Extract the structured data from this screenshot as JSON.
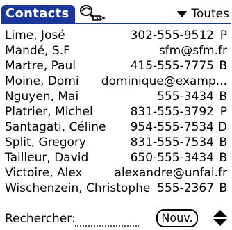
{
  "app": {
    "title": "Contacts"
  },
  "header": {
    "category": "Toutes",
    "lookup_icon": "lookup-icon",
    "category_icon": "triangle-down-icon"
  },
  "contacts": [
    {
      "name": "Lime, José",
      "value": "302-555-9512",
      "type": "P"
    },
    {
      "name": "Mandé, S.F",
      "value": "sfm@sfm.fr",
      "type": ""
    },
    {
      "name": "Martre, Paul",
      "value": "415-555-7775",
      "type": "B"
    },
    {
      "name": "Moine, Domi",
      "value": "dominique@examp...",
      "type": ""
    },
    {
      "name": "Nguyen, Mai",
      "value": "555-3434",
      "type": "B"
    },
    {
      "name": "Platrier, Michel",
      "value": "831-555-3792",
      "type": "P"
    },
    {
      "name": "Santagati, Céline",
      "value": "954-555-7534",
      "type": "D"
    },
    {
      "name": "Split, Gregory",
      "value": "831-555-7534",
      "type": "B"
    },
    {
      "name": "Tailleur, David",
      "value": "650-555-3434",
      "type": "B"
    },
    {
      "name": "Victoire, Alex",
      "value": "alexandre@unfai.fr",
      "type": ""
    },
    {
      "name": "Wischenzein, Christophe",
      "value": "555-2367",
      "type": "B"
    }
  ],
  "footer": {
    "search_label": "Rechercher:",
    "search_value": "",
    "new_button": "Nouv."
  }
}
